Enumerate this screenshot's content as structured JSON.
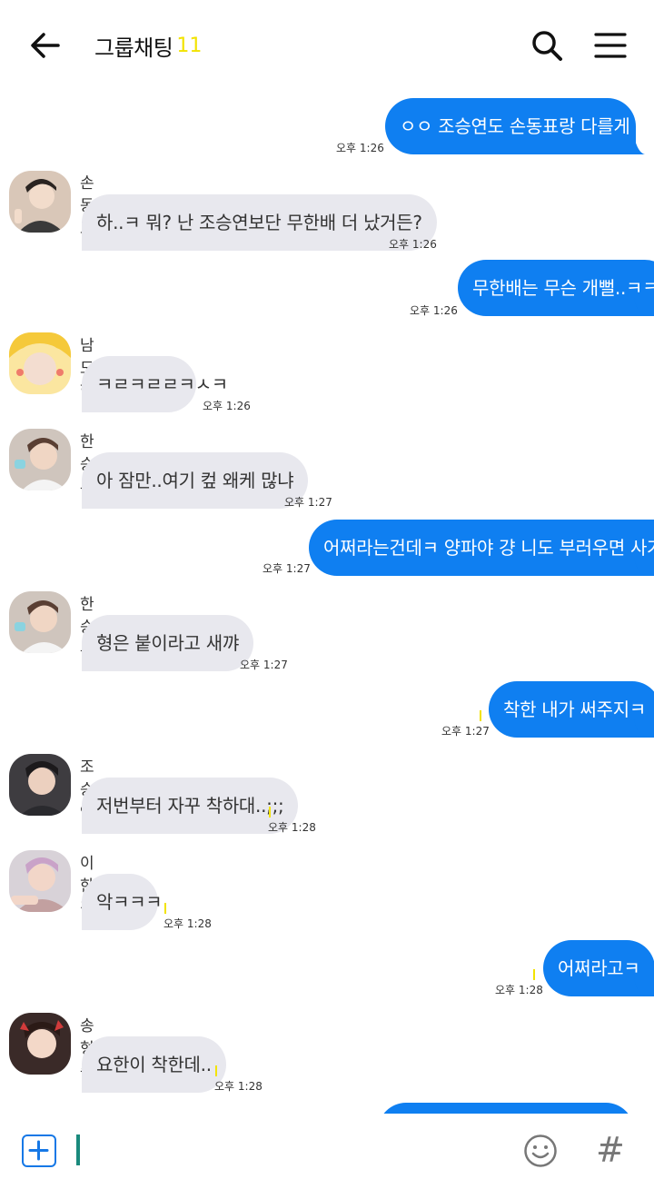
{
  "header": {
    "title": "그룹채팅",
    "count": "11"
  },
  "messages": [
    {
      "side": "me",
      "text": "ㅇㅇ 조승연도 손동표랑 다를게 없네",
      "time": "오후 1:26"
    },
    {
      "side": "them",
      "sender": "손동표",
      "text": "하..ㅋ 뭐? 난 조승연보단 무한배 더 났거든?",
      "time": "오후 1:26"
    },
    {
      "side": "me",
      "text": "무한배는 무슨 개뻘..ㅋㅋ",
      "time": "오후 1:26"
    },
    {
      "side": "them",
      "sender": "남도현",
      "text": "ㅋㄹㅋㄹㄹㅋㅅㅋ",
      "time": "오후 1:26"
    },
    {
      "side": "them",
      "sender": "한승우",
      "text": "아 잠만..여기 컾 왜케 많냐",
      "time": "오후 1:27"
    },
    {
      "side": "me",
      "text": "어쩌라는건데ㅋ 양파야 걍 니도 부러우면 사겨ㅋ",
      "time": "오후 1:27"
    },
    {
      "side": "them",
      "sender": "한승우",
      "text": "형은 붙이라고 새꺄",
      "time": "오후 1:27"
    },
    {
      "side": "me",
      "text": "착한 내가 써주지ㅋ",
      "time": "오후 1:27"
    },
    {
      "side": "them",
      "sender": "조승연",
      "text": "저번부터 자꾸 착하대..;;;",
      "time": "오후 1:28"
    },
    {
      "side": "them",
      "sender": "이한결",
      "text": "악ㅋㅋㅋ",
      "time": "오후 1:28"
    },
    {
      "side": "me",
      "text": "어쩌라고ㅋ",
      "time": "오후 1:28"
    },
    {
      "side": "them",
      "sender": "송형준",
      "text": "요한이 착한데..",
      "time": "오후 1:28"
    }
  ],
  "colors": {
    "my_bubble": "#0f7ff1",
    "their_bubble": "#e8e8ee",
    "unread_marker": "#f2e300",
    "accent": "#1678e6"
  },
  "icons": {
    "back": "arrow-left-icon",
    "search": "search-icon",
    "menu": "hamburger-menu-icon",
    "add": "plus-icon",
    "emoji": "smiley-icon",
    "hash": "hash-icon"
  },
  "input": {
    "value": "",
    "hash_label": "#"
  }
}
